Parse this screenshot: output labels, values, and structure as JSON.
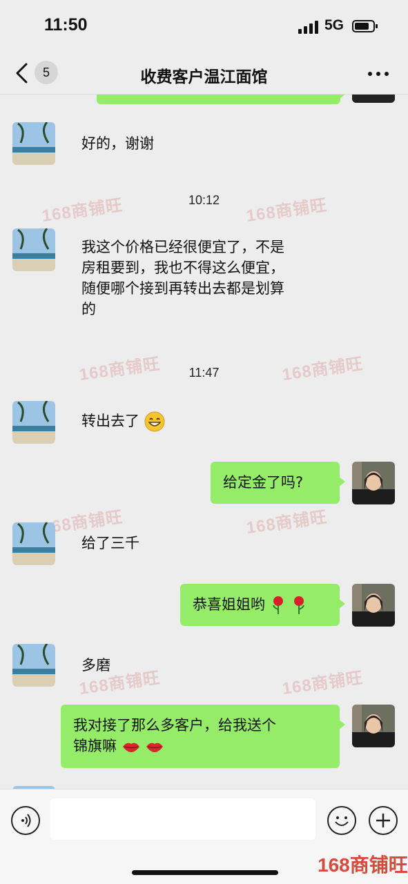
{
  "status_bar": {
    "time": "11:50",
    "network": "5G"
  },
  "header": {
    "unread_count": "5",
    "title": "收费客户温江面馆"
  },
  "watermark": "168商铺旺",
  "messages": [
    {
      "side": "left",
      "text": "好的，谢谢"
    },
    {
      "type": "time",
      "text": "10:12"
    },
    {
      "side": "left",
      "lines": [
        "我这个价格已经很便宜了，不是",
        "房租要到，我也不得这么便宜，",
        "随便哪个接到再转出去都是划算",
        "的"
      ]
    },
    {
      "type": "time",
      "text": "11:47"
    },
    {
      "side": "left",
      "text": "转出去了",
      "emoji": "grin-emoji"
    },
    {
      "side": "right",
      "text": "给定金了吗?"
    },
    {
      "side": "left",
      "text": "给了三千"
    },
    {
      "side": "right",
      "text": "恭喜姐姐哟",
      "emoji": "rose-emoji"
    },
    {
      "side": "left",
      "text": "多磨"
    },
    {
      "side": "right",
      "lines": [
        "我对接了那么多客户，给我送个",
        "锦旗嘛"
      ],
      "emoji": "lips-emoji"
    }
  ],
  "colors": {
    "bubble_green": "#95ec69",
    "background": "#ededed",
    "watermark": "#d84a3a"
  }
}
